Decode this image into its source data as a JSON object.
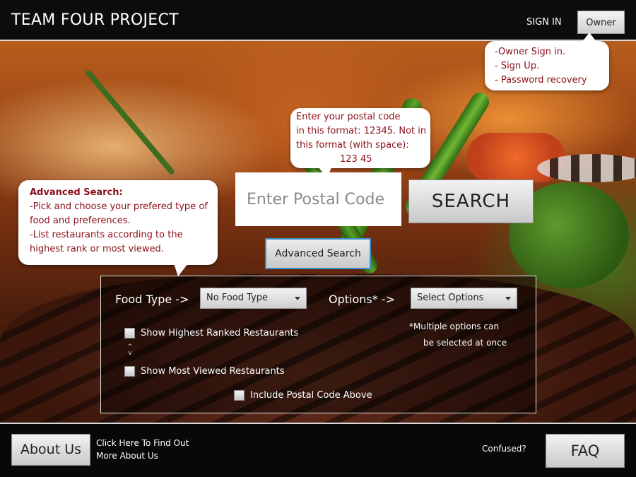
{
  "header": {
    "title": "TEAM FOUR PROJECT",
    "sign_in": "SIGN IN",
    "owner_button": "Owner"
  },
  "owner_callout": {
    "lines": [
      "-Owner Sign in.",
      "- Sign Up.",
      "- Password recovery"
    ]
  },
  "postal_callout": {
    "lines": [
      "Enter your postal code",
      "in this format: 12345. Not in",
      "this format (with space):",
      "123 45"
    ]
  },
  "search": {
    "placeholder": "Enter Postal Code",
    "value": "",
    "button_label": "SEARCH",
    "advanced_button_label": "Advanced Search"
  },
  "advanced_callout": {
    "title": "Advanced Search:",
    "lines": [
      "-Pick and choose your prefered type of",
      "food and preferences.",
      "-List restaurants according to the",
      "highest  rank or most viewed."
    ]
  },
  "advanced_panel": {
    "food_type_label": "Food Type ->",
    "food_type_selected": "No Food Type",
    "options_label": "Options* ->",
    "options_selected": "Select Options",
    "multi_note": [
      "*Multiple options can",
      "be selected at once"
    ],
    "either_or_marks": [
      "^",
      "v"
    ],
    "show_highest_ranked": "Show Highest Ranked Restaurants",
    "show_most_viewed": "Show Most Viewed Restaurants",
    "include_postal": "Include Postal Code Above"
  },
  "footer": {
    "about_button": "About Us",
    "about_text": [
      "Click Here To Find Out",
      "More About Us"
    ],
    "confused": "Confused?",
    "faq_button": "FAQ"
  },
  "colors": {
    "callout_text": "#8b0f18",
    "advanced_button_border": "#3d8ec9"
  }
}
